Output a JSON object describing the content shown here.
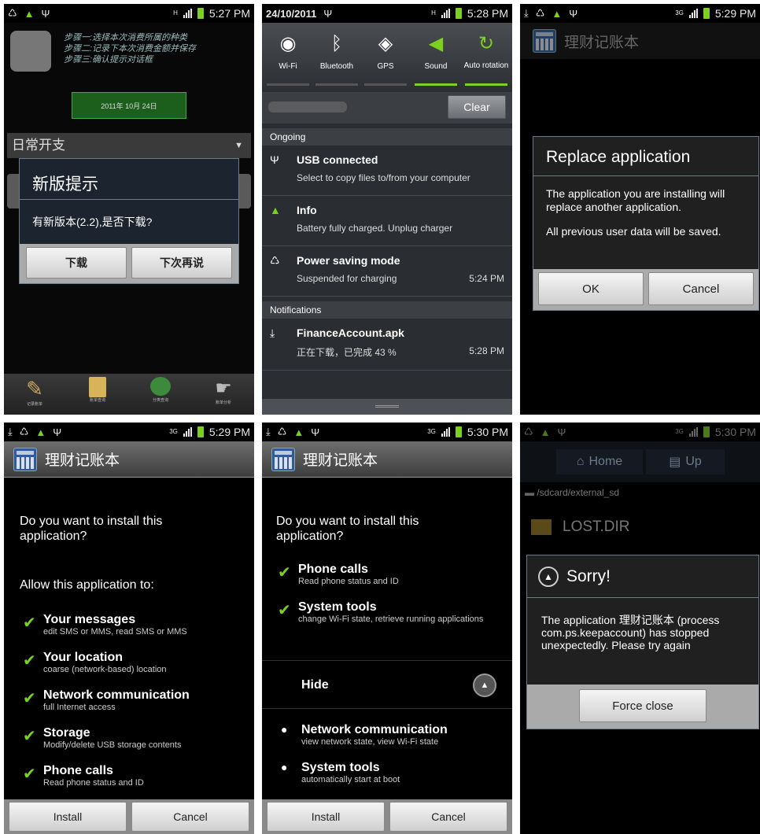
{
  "p1": {
    "time": "5:27 PM",
    "steps": [
      "步骤一:选择本次消费所属的种类",
      "步骤二:记录下本次消费金额并保存",
      "步骤三:确认提示对话框"
    ],
    "date": "2011年 10月 24日",
    "category": "日常开支",
    "dialog_title": "新版提示",
    "dialog_msg": "有新版本(2.2),是否下载?",
    "btn_download": "下载",
    "btn_later": "下次再说",
    "tabs": [
      "记录账单",
      "账单查询",
      "分类查询",
      "账单分析"
    ]
  },
  "p2": {
    "date": "24/10/2011",
    "time": "5:28 PM",
    "toggles": [
      "Wi-Fi",
      "Bluetooth",
      "GPS",
      "Sound",
      "Auto rotation"
    ],
    "clear": "Clear",
    "ongoing": "Ongoing",
    "notifs": [
      {
        "title": "USB connected",
        "sub": "Select to copy files to/from your computer",
        "time": ""
      },
      {
        "title": "Info",
        "sub": "Battery fully charged. Unplug charger",
        "time": ""
      },
      {
        "title": "Power saving mode",
        "sub": "Suspended for charging",
        "time": "5:24 PM"
      }
    ],
    "notifications": "Notifications",
    "dl": {
      "title": "FinanceAccount.apk",
      "sub": "正在下载，已完成 43 %",
      "time": "5:28 PM"
    }
  },
  "p3": {
    "time": "5:29 PM",
    "app": "理财记账本",
    "title": "Replace application",
    "msg1": "The application you are installing will replace another application.",
    "msg2": "All previous user data will be saved.",
    "ok": "OK",
    "cancel": "Cancel"
  },
  "p4": {
    "time": "5:29 PM",
    "app": "理财记账本",
    "q": "Do you want to install this application?",
    "allow": "Allow this application to:",
    "perms": [
      {
        "t": "Your messages",
        "s": "edit SMS or MMS, read SMS or MMS"
      },
      {
        "t": "Your location",
        "s": "coarse (network-based) location"
      },
      {
        "t": "Network communication",
        "s": "full Internet access"
      },
      {
        "t": "Storage",
        "s": "Modify/delete USB storage contents"
      },
      {
        "t": "Phone calls",
        "s": "Read phone status and ID"
      }
    ],
    "install": "Install",
    "cancel": "Cancel"
  },
  "p5": {
    "time": "5:30 PM",
    "app": "理财记账本",
    "q": "Do you want to install this application?",
    "perms": [
      {
        "t": "Phone calls",
        "s": "Read phone status and ID"
      },
      {
        "t": "System tools",
        "s": "change Wi-Fi state, retrieve running applications"
      }
    ],
    "hide": "Hide",
    "hidden": [
      {
        "t": "Network communication",
        "s": "view network state, view Wi-Fi state"
      },
      {
        "t": "System tools",
        "s": "automatically start at boot"
      }
    ],
    "install": "Install",
    "cancel": "Cancel"
  },
  "p6": {
    "time": "5:30 PM",
    "home": "Home",
    "up": "Up",
    "path": "/sdcard/external_sd",
    "folder": "LOST.DIR",
    "title": "Sorry!",
    "msg": "The application 理财记账本 (process com.ps.keepaccount) has stopped unexpectedly. Please try again",
    "force": "Force close"
  },
  "colors": {
    "accent": "#7bd11e",
    "bg": "#000000"
  }
}
